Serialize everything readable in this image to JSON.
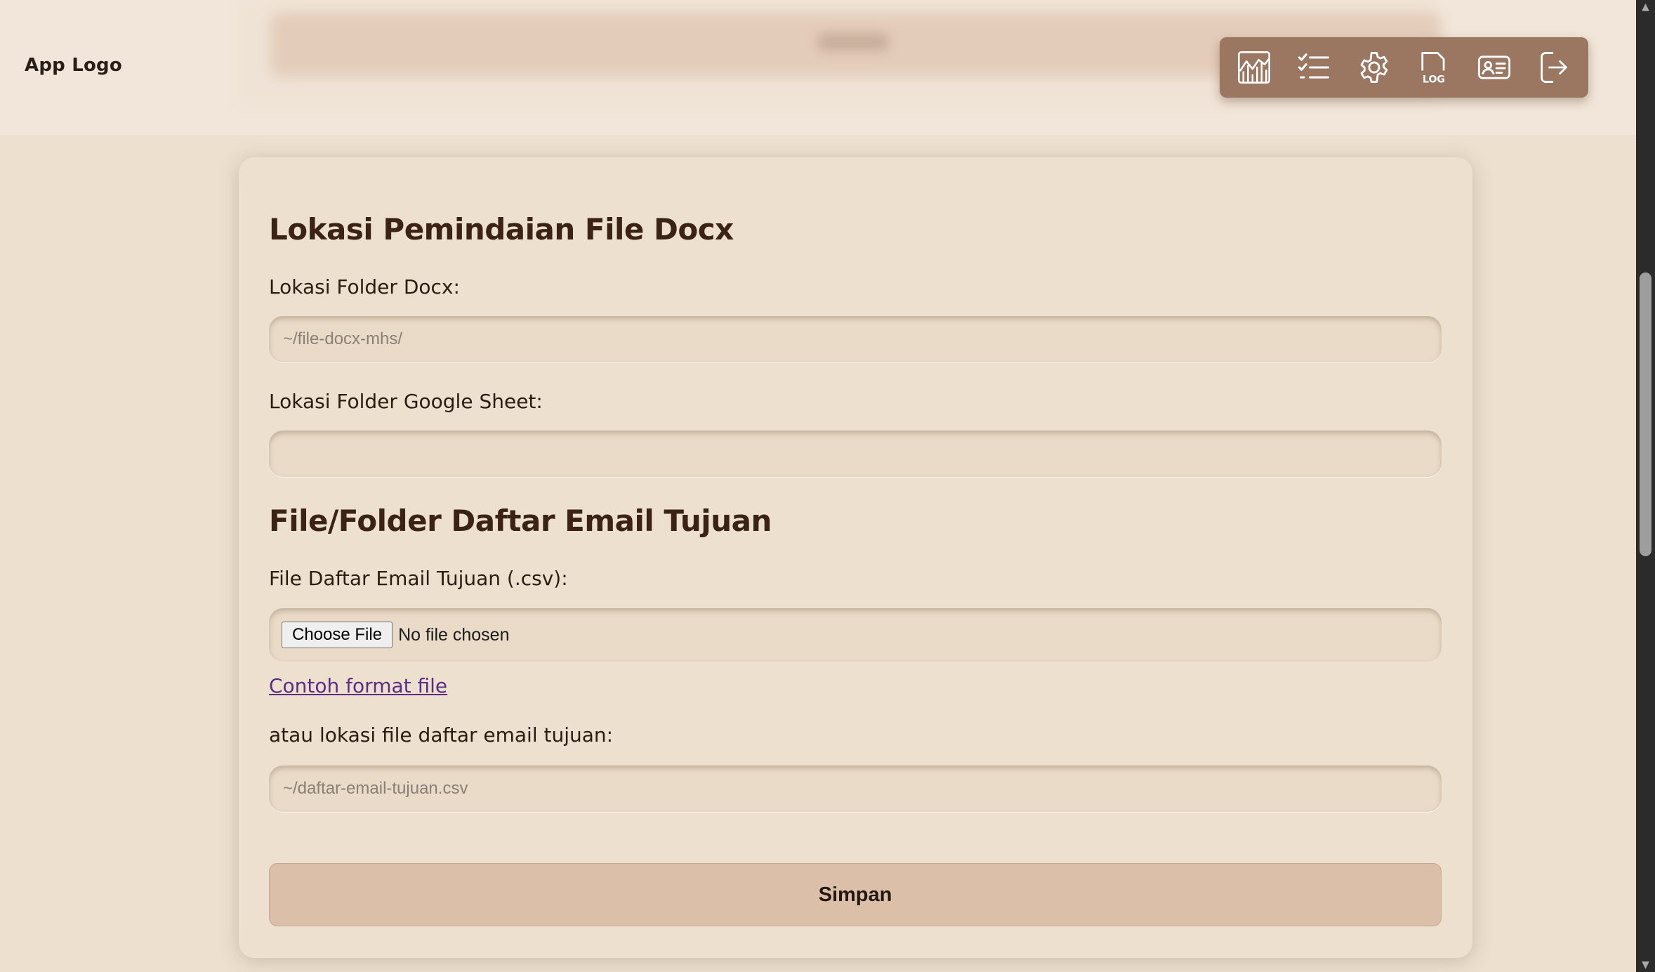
{
  "header": {
    "logo": "App Logo",
    "toolbar": [
      {
        "icon": "chart-icon",
        "label": "Statistik"
      },
      {
        "icon": "checklist-icon",
        "label": "Daftar"
      },
      {
        "icon": "gear-icon",
        "label": "Pengaturan"
      },
      {
        "icon": "log-file-icon",
        "label": "Log",
        "badge": "LOG"
      },
      {
        "icon": "id-card-icon",
        "label": "Profil"
      },
      {
        "icon": "logout-icon",
        "label": "Keluar"
      }
    ]
  },
  "form": {
    "section_docx": {
      "title": "Lokasi Pemindaian File Docx",
      "docx_label": "Lokasi Folder Docx:",
      "docx_placeholder": "~/file-docx-mhs/",
      "docx_value": "",
      "sheet_label": "Lokasi Folder Google Sheet:",
      "sheet_placeholder": "",
      "sheet_value": ""
    },
    "section_email": {
      "title": "File/Folder Daftar Email Tujuan",
      "csv_label": "File Daftar Email Tujuan (.csv):",
      "choose_file": "Choose File",
      "no_file": "No file chosen",
      "example_link": "Contoh format file",
      "path_label": "atau lokasi file daftar email tujuan:",
      "path_placeholder": "~/daftar-email-tujuan.csv",
      "path_value": ""
    },
    "save_label": "Simpan"
  },
  "colors": {
    "background": "#ede0cf",
    "header": "#f1e6d9",
    "toolbar": "#9b7660",
    "button": "#dcbfa9",
    "title": "#3a2214",
    "link": "#5b2d86"
  },
  "scrollbar": {
    "up_arrow": "▲",
    "down_arrow": "▼"
  }
}
